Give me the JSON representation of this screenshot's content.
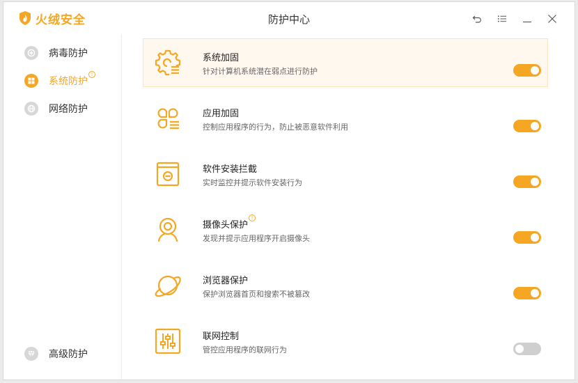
{
  "app": {
    "brand": "火绒安全",
    "title": "防护中心"
  },
  "window_controls": [
    "back-icon",
    "menu-icon",
    "minimize-icon",
    "close-icon"
  ],
  "sidebar": {
    "items": [
      {
        "label": "病毒防护",
        "icon": "virus-shield-icon",
        "active": false
      },
      {
        "label": "系统防护",
        "icon": "windows-shield-icon",
        "active": true,
        "badge": "!"
      },
      {
        "label": "网络防护",
        "icon": "globe-icon",
        "active": false
      },
      {
        "label": "高级防护",
        "icon": "diamond-icon",
        "active": false
      }
    ]
  },
  "features": [
    {
      "title": "系统加固",
      "desc": "针对计算机系统潜在弱点进行防护",
      "icon": "gear-list-icon",
      "enabled": true
    },
    {
      "title": "应用加固",
      "desc": "控制应用程序的行为，防止被恶意软件利用",
      "icon": "app-grid-icon",
      "enabled": true
    },
    {
      "title": "软件安装拦截",
      "desc": "实时监控并提示软件安装行为",
      "icon": "install-box-icon",
      "enabled": true
    },
    {
      "title": "摄像头保护",
      "desc": "发现并提示应用程序开启摄像头",
      "icon": "webcam-icon",
      "enabled": true,
      "badge": "!"
    },
    {
      "title": "浏览器保护",
      "desc": "保护浏览器首页和搜索不被篡改",
      "icon": "planet-icon",
      "enabled": true
    },
    {
      "title": "联网控制",
      "desc": "管控应用程序的联网行为",
      "icon": "sliders-icon",
      "enabled": false
    }
  ],
  "colors": {
    "accent": "#f5a623",
    "toggle_off": "#cfcfcf",
    "highlight_bg": "#fef8ef"
  }
}
